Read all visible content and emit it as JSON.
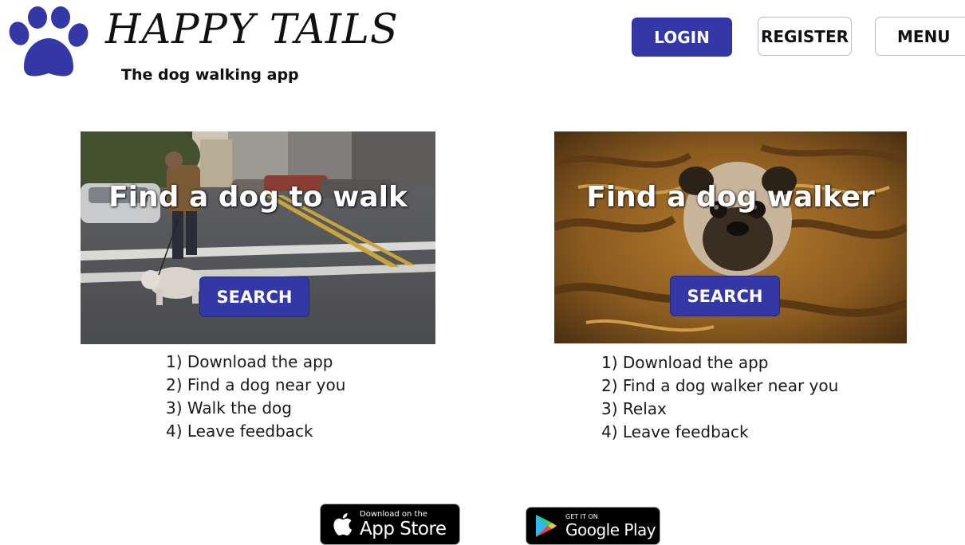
{
  "header": {
    "brand_title": "HAPPY TAILS",
    "brand_subtitle": "The dog walking app",
    "login_label": "LOGIN",
    "register_label": "REGISTER",
    "menu_label": "MENU",
    "logo_icon": "paw-icon"
  },
  "cards": [
    {
      "title": "Find a dog to walk",
      "button_label": "SEARCH",
      "image": "man-walking-dog-on-street-photo",
      "steps": [
        "1) Download the app",
        "2) Find a dog near you",
        "3) Walk the dog",
        "4) Leave feedback"
      ]
    },
    {
      "title": "Find a dog walker",
      "button_label": "SEARCH",
      "image": "pug-in-blanket-photo",
      "steps": [
        "1) Download the app",
        "2) Find a dog walker near you",
        "3) Relax",
        "4) Leave feedback"
      ]
    }
  ],
  "store_badges": {
    "apple_small": "Download on the",
    "apple_big": "App Store",
    "apple_icon": "apple-icon",
    "google_small": "GET IT ON",
    "google_big": "Google Play",
    "google_icon": "google-play-icon"
  },
  "colors": {
    "brand_primary": "#3438a6",
    "logo_paw": "#3438a6",
    "text": "#111111",
    "background": "#ffffff"
  }
}
